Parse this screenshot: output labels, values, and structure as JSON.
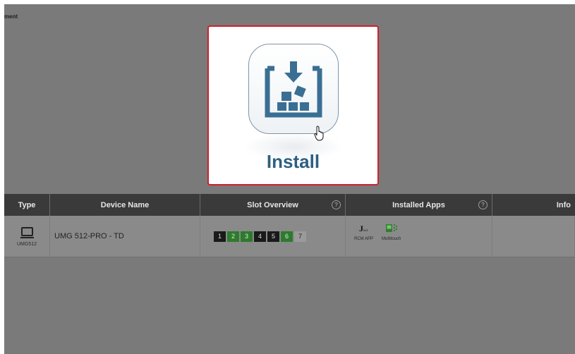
{
  "breadcrumb": "ment",
  "install": {
    "label": "Install",
    "icon": "install-download-icon",
    "highlight_color": "#d01f2a",
    "accent_color": "#2d5f82"
  },
  "table": {
    "columns": [
      {
        "label": "Type"
      },
      {
        "label": "Device Name"
      },
      {
        "label": "Slot Overview",
        "help": "?"
      },
      {
        "label": "Installed Apps",
        "help": "?"
      },
      {
        "label": "Info"
      }
    ],
    "rows": [
      {
        "type_icon": "device-monitor-icon",
        "type_label": "UMG512",
        "device_name": "UMG 512-PRO - TD",
        "slots": [
          {
            "label": "1",
            "state": "dark"
          },
          {
            "label": "2",
            "state": "green"
          },
          {
            "label": "3",
            "state": "green"
          },
          {
            "label": "4",
            "state": "dark"
          },
          {
            "label": "5",
            "state": "dark"
          },
          {
            "label": "6",
            "state": "green"
          },
          {
            "label": "7",
            "state": "empty"
          }
        ],
        "apps": [
          {
            "icon": "rcm-app-icon",
            "label": "RCM APP"
          },
          {
            "icon": "multitouch-icon",
            "label": "Multitouch"
          }
        ],
        "info": ""
      }
    ]
  },
  "colors": {
    "slot_dark": "#1a1a1a",
    "slot_green": "#2e7a2e",
    "header_bg": "#3a3a3a",
    "overlay_bg": "#7a7a7a"
  }
}
